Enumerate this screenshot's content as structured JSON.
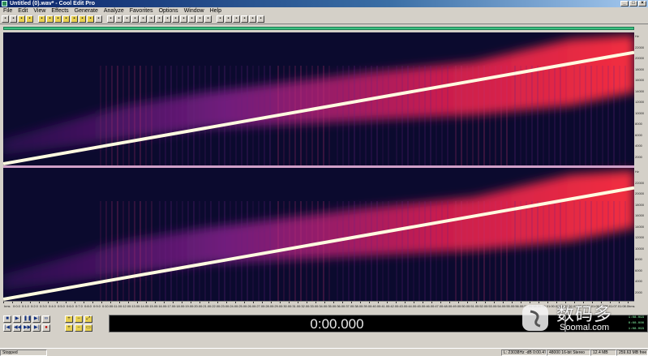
{
  "window": {
    "title": "Untitled (0).wav* - Cool Edit Pro",
    "controls": [
      "_",
      "□",
      "×"
    ]
  },
  "menu": {
    "items": [
      "File",
      "Edit",
      "View",
      "Effects",
      "Generate",
      "Analyze",
      "Favorites",
      "Options",
      "Window",
      "Help"
    ]
  },
  "toolbar": {
    "buttons": [
      {
        "icon": "multitrack-icon"
      },
      {
        "icon": "waveform-icon"
      },
      {
        "icon": "open-icon"
      },
      {
        "icon": "save-icon"
      },
      {
        "icon": "cut-icon"
      },
      {
        "icon": "copy-icon"
      },
      {
        "icon": "paste-icon"
      },
      {
        "icon": "undo-icon"
      },
      {
        "icon": "redo-icon"
      },
      {
        "icon": "mix-paste-icon"
      },
      {
        "icon": "trim-icon"
      },
      {
        "icon": "new-icon"
      },
      {
        "icon": "record-settings-icon"
      },
      {
        "icon": "amplify-icon"
      },
      {
        "icon": "normalize-icon"
      },
      {
        "icon": "envelope-icon"
      },
      {
        "icon": "noise-icon"
      },
      {
        "icon": "reverb-icon"
      },
      {
        "icon": "delay-icon"
      },
      {
        "icon": "echo-icon"
      },
      {
        "icon": "filter-icon"
      },
      {
        "icon": "eq-icon"
      },
      {
        "icon": "stretch-icon"
      },
      {
        "icon": "pitch-icon"
      },
      {
        "icon": "tone-icon"
      },
      {
        "icon": "analyze-icon"
      },
      {
        "icon": "spectral-icon"
      },
      {
        "icon": "cue-icon"
      },
      {
        "icon": "settings-icon"
      },
      {
        "icon": "help-icon"
      },
      {
        "icon": "about-icon"
      }
    ]
  },
  "spectral_view": {
    "channels": [
      "left",
      "right"
    ],
    "sweep": {
      "start_fraction": 0.0,
      "end_fraction": 0.85
    }
  },
  "vertical_scale": {
    "labels": [
      "Hz",
      "22000",
      "20000",
      "18000",
      "16000",
      "14000",
      "12000",
      "10000",
      "8000",
      "6000",
      "4000",
      "2000"
    ]
  },
  "timeline": {
    "labels": [
      "hms",
      "0:0.0",
      "0:1.0",
      "0:2.0",
      "0:3.0",
      "0:4.0",
      "0:5.0",
      "0:6.0",
      "0:7.0",
      "0:8.0",
      "0:9.0",
      "0:10.0",
      "0:11.0",
      "0:12.0",
      "0:13.0",
      "0:14.0",
      "0:15.0",
      "0:16.0",
      "0:17.0",
      "0:18.0",
      "0:19.0",
      "0:20.0",
      "0:21.0",
      "0:22.0",
      "0:23.0",
      "0:24.0",
      "0:25.0",
      "0:26.0",
      "0:27.0",
      "0:28.0",
      "0:29.0",
      "0:30.0",
      "0:31.0",
      "0:32.0",
      "0:33.0",
      "0:34.0",
      "0:35.0",
      "0:36.0",
      "0:37.0",
      "0:38.0",
      "0:39.0",
      "0:40.0",
      "0:41.0",
      "0:42.0",
      "0:43.0",
      "0:44.0",
      "0:45.0",
      "0:46.0",
      "0:47.0",
      "0:48.0",
      "0:49.0",
      "0:50.0",
      "0:51.0",
      "0:52.0",
      "0:53.0",
      "0:54.0",
      "0:55.0",
      "0:56.0",
      "0:57.0",
      "0:58.0",
      "0:59.0",
      "1:00.0",
      "1:01.0",
      "1:02.0",
      "1:03.0",
      "1:04.0",
      "1:05.0",
      "1:06.0",
      "1:07.0",
      "1:08.0",
      "hms"
    ]
  },
  "transport": {
    "row1": [
      {
        "name": "stop-button",
        "icon": "stop-icon",
        "glyph": "■"
      },
      {
        "name": "play-button",
        "icon": "play-icon",
        "glyph": "▶"
      },
      {
        "name": "pause-button",
        "icon": "pause-icon",
        "glyph": "❚❚"
      },
      {
        "name": "play-to-end-button",
        "icon": "play-to-end-icon",
        "glyph": "▶|"
      },
      {
        "name": "loop-button",
        "icon": "loop-icon",
        "glyph": "∞"
      }
    ],
    "row2": [
      {
        "name": "go-to-start-button",
        "icon": "go-to-start-icon",
        "glyph": "|◀"
      },
      {
        "name": "rewind-button",
        "icon": "rewind-icon",
        "glyph": "◀◀"
      },
      {
        "name": "fast-forward-button",
        "icon": "fast-forward-icon",
        "glyph": "▶▶"
      },
      {
        "name": "go-to-end-button",
        "icon": "go-to-end-icon",
        "glyph": "▶|"
      },
      {
        "name": "record-button",
        "icon": "record-icon",
        "glyph": "●"
      }
    ]
  },
  "zoom": {
    "buttons": [
      {
        "name": "zoom-in-horizontal-button",
        "icon": "zoom-in-icon",
        "glyph": "+"
      },
      {
        "name": "zoom-out-horizontal-button",
        "icon": "zoom-out-icon",
        "glyph": "−"
      },
      {
        "name": "zoom-full-button",
        "icon": "zoom-full-icon",
        "glyph": "⤢"
      },
      {
        "name": "zoom-in-vertical-button",
        "icon": "zoom-in-vertical-icon",
        "glyph": "+"
      },
      {
        "name": "zoom-out-vertical-button",
        "icon": "zoom-out-vertical-icon",
        "glyph": "−"
      },
      {
        "name": "zoom-selection-button",
        "icon": "zoom-selection-icon",
        "glyph": "▭"
      }
    ]
  },
  "time_display": {
    "value": "0:00.000"
  },
  "level_panel": {
    "values": [
      "1:08.093",
      "0:00.000",
      "1:08.093"
    ]
  },
  "logo": {
    "chinese": "数码多",
    "english": "Soomal.com"
  },
  "status": {
    "state": "Stopped",
    "cells": [
      "L: 23038Hz -dB  0:00.475",
      "48000 16-bit Stereo",
      "12.4 MB",
      "259.63 MB free"
    ]
  },
  "colors": {
    "background": "#0b0a2e",
    "sweep": "#fffbe0",
    "energy_hot": "#ff3040",
    "energy_mid": "#a02090",
    "overview": "#3cc080"
  }
}
